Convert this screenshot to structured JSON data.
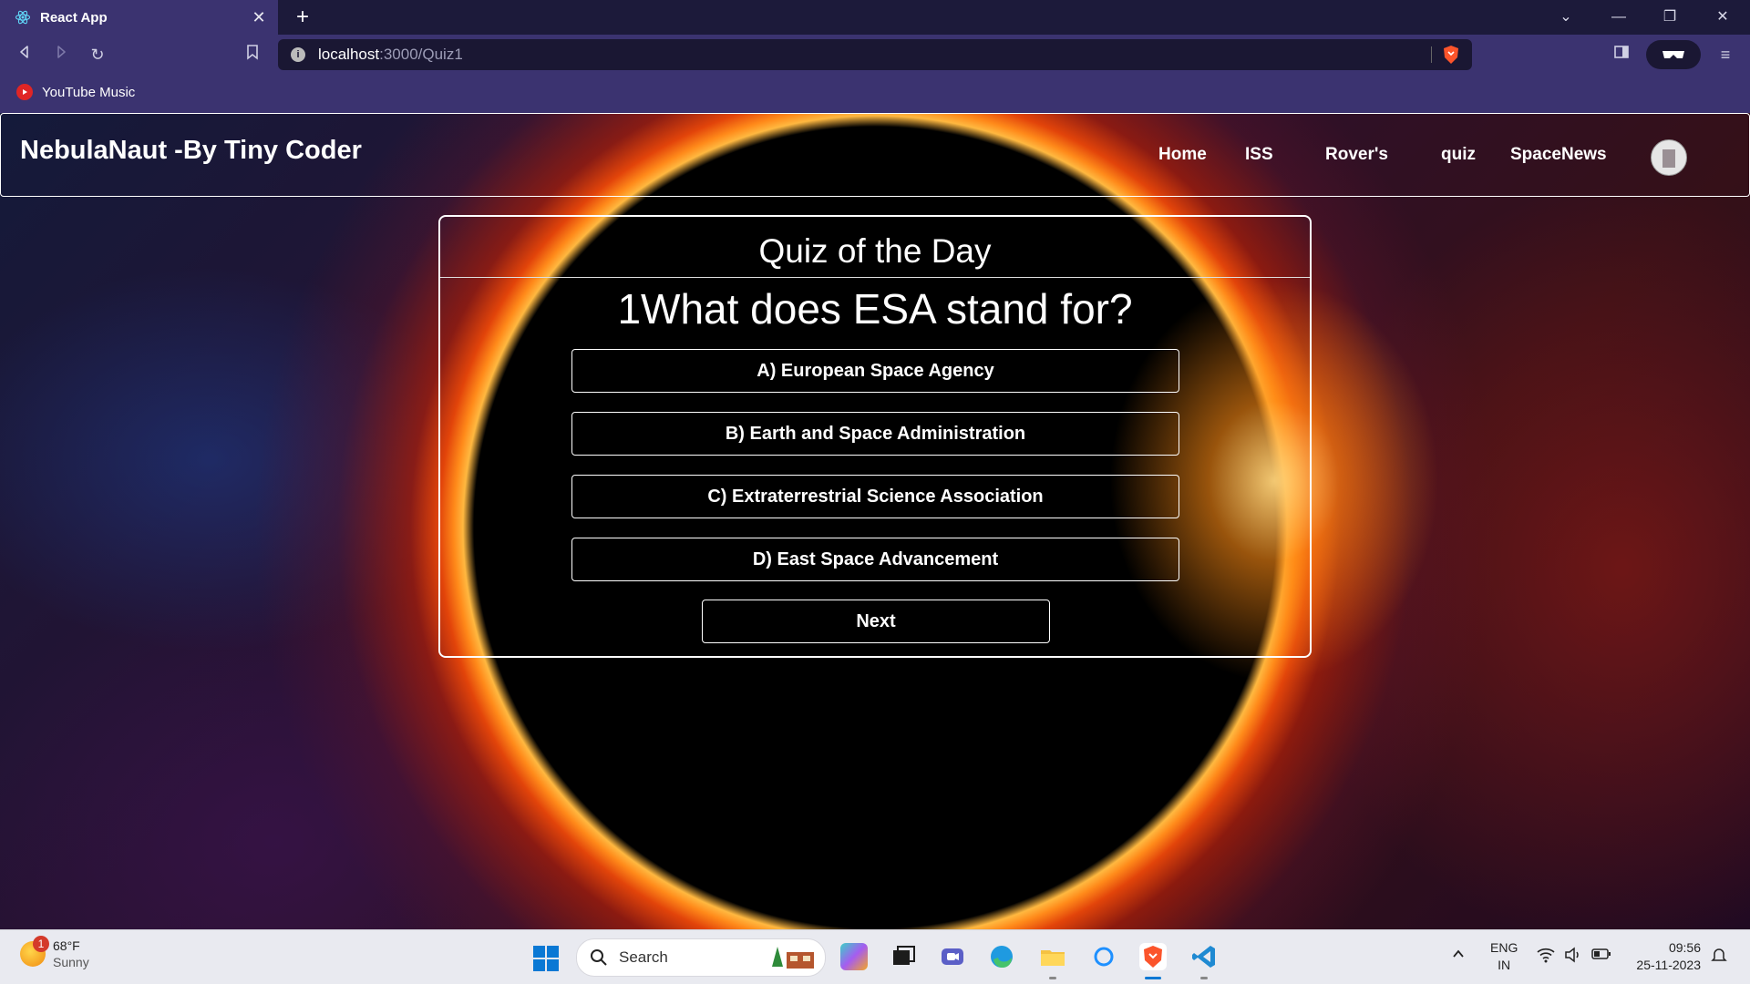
{
  "browser": {
    "tab_title": "React App",
    "url_host": "localhost",
    "url_path": ":3000/Quiz1",
    "bookmark": "YouTube Music"
  },
  "navbar": {
    "brand": "NebulaNaut -By Tiny Coder",
    "links": [
      "Home",
      "ISS",
      "Rover's",
      "quiz",
      "SpaceNews"
    ]
  },
  "quiz": {
    "title": "Quiz of the Day",
    "question": "1What does ESA stand for?",
    "options": [
      "A) European Space Agency",
      "B) Earth and Space Administration",
      "C) Extraterrestrial Science Association",
      "D) East Space Advancement"
    ],
    "next_label": "Next"
  },
  "taskbar": {
    "weather_badge": "1",
    "temperature": "68°F",
    "condition": "Sunny",
    "search_label": "Search",
    "lang": "ENG",
    "region": "IN",
    "time": "09:56",
    "date": "25-11-2023"
  },
  "colors": {
    "browser_frame": "#3b3370",
    "quiz_border": "#ffffff",
    "flare": "#ff8a1a"
  }
}
